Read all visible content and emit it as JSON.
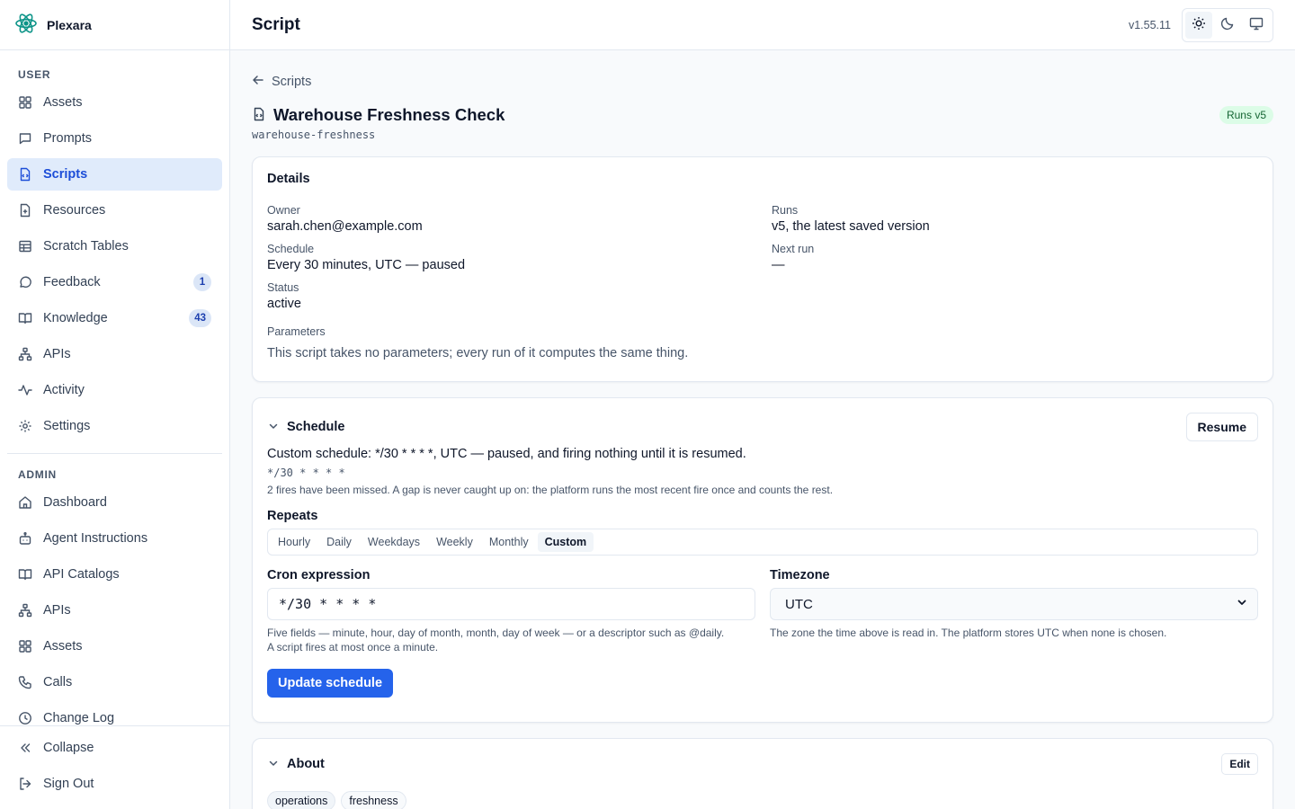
{
  "brand": {
    "name": "Plexara"
  },
  "sidebar": {
    "user_label": "USER",
    "user_items": [
      {
        "label": "Assets",
        "icon": "grid-icon"
      },
      {
        "label": "Prompts",
        "icon": "message-square-icon"
      },
      {
        "label": "Scripts",
        "icon": "file-code-icon",
        "active": true
      },
      {
        "label": "Resources",
        "icon": "file-plus-icon"
      },
      {
        "label": "Scratch Tables",
        "icon": "table-icon"
      },
      {
        "label": "Feedback",
        "icon": "message-circle-icon",
        "badge": "1"
      },
      {
        "label": "Knowledge",
        "icon": "book-open-icon",
        "badge": "43"
      },
      {
        "label": "APIs",
        "icon": "network-icon"
      },
      {
        "label": "Activity",
        "icon": "activity-icon"
      },
      {
        "label": "Settings",
        "icon": "gear-icon"
      }
    ],
    "admin_label": "ADMIN",
    "admin_items": [
      {
        "label": "Dashboard",
        "icon": "home-icon"
      },
      {
        "label": "Agent Instructions",
        "icon": "bot-icon"
      },
      {
        "label": "API Catalogs",
        "icon": "book-open-icon"
      },
      {
        "label": "APIs",
        "icon": "network-icon"
      },
      {
        "label": "Assets",
        "icon": "grid-icon"
      },
      {
        "label": "Calls",
        "icon": "phone-icon"
      },
      {
        "label": "Change Log",
        "icon": "clock-icon"
      }
    ],
    "footer": {
      "collapse": "Collapse",
      "sign_out": "Sign Out"
    }
  },
  "header": {
    "title": "Script",
    "version": "v1.55.11"
  },
  "breadcrumb": {
    "back_label": "Scripts"
  },
  "script": {
    "title": "Warehouse Freshness Check",
    "slug": "warehouse-freshness",
    "runs_badge": "Runs v5"
  },
  "details": {
    "title": "Details",
    "owner_label": "Owner",
    "owner_value": "sarah.chen@example.com",
    "runs_label": "Runs",
    "runs_value": "v5, the latest saved version",
    "schedule_label": "Schedule",
    "schedule_value": "Every 30 minutes, UTC — paused",
    "next_run_label": "Next run",
    "next_run_value": "—",
    "status_label": "Status",
    "status_value": "active",
    "parameters_label": "Parameters",
    "parameters_value": "This script takes no parameters; every run of it computes the same thing."
  },
  "schedule": {
    "title": "Schedule",
    "resume_label": "Resume",
    "description": "Custom schedule: */30 * * * *, UTC — paused, and firing nothing until it is resumed.",
    "cron_display": "*/30 * * * *",
    "missed_note": "2 fires have been missed. A gap is never caught up on: the platform runs the most recent fire once and counts the rest.",
    "repeats_label": "Repeats",
    "repeat_tabs": [
      "Hourly",
      "Daily",
      "Weekdays",
      "Weekly",
      "Monthly",
      "Custom"
    ],
    "active_tab": "Custom",
    "cron_label": "Cron expression",
    "cron_value": "*/30 * * * *",
    "cron_hint_1": "Five fields — minute, hour, day of month, month, day of week — or a descriptor such as @daily.",
    "cron_hint_2": "A script fires at most once a minute.",
    "timezone_label": "Timezone",
    "timezone_value": "UTC",
    "timezone_hint": "The zone the time above is read in. The platform stores UTC when none is chosen.",
    "update_label": "Update schedule"
  },
  "about": {
    "title": "About",
    "edit_label": "Edit",
    "tags": [
      "operations",
      "freshness"
    ]
  },
  "colors": {
    "accent": "#2563eb",
    "active_nav_bg": "#e0ebfb",
    "runs_badge_bg": "#dcfce7",
    "runs_badge_text": "#166534"
  }
}
